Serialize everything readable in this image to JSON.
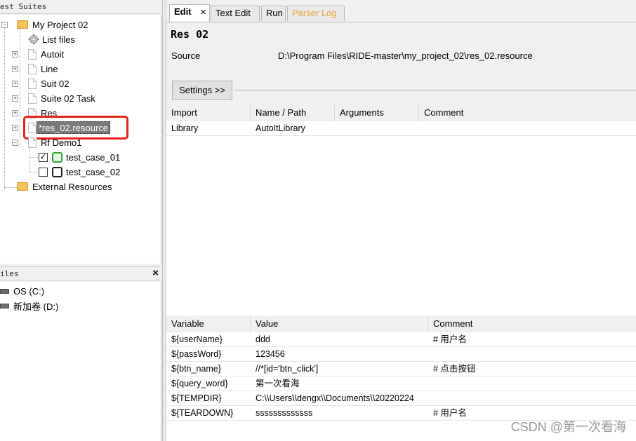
{
  "tree_panel": {
    "header": "est Suites",
    "items": [
      {
        "label": "My Project 02",
        "icon": "folder-icon"
      },
      {
        "label": "List files",
        "icon": "gear-icon"
      },
      {
        "label": "Autoit",
        "icon": "file-icon"
      },
      {
        "label": "Line",
        "icon": "file-icon"
      },
      {
        "label": "Suit 02",
        "icon": "file-icon"
      },
      {
        "label": "Suite 02 Task",
        "icon": "file-icon"
      },
      {
        "label": "Res",
        "icon": "gear-file-icon"
      },
      {
        "label": "*res_02.resource",
        "icon": "gear-file-icon"
      },
      {
        "label": "Rf Demo1",
        "icon": "file-icon"
      },
      {
        "label": "test_case_01",
        "icon": "robot-green-icon"
      },
      {
        "label": "test_case_02",
        "icon": "robot-black-icon"
      },
      {
        "label": "External Resources",
        "icon": "folder-gear-icon"
      }
    ]
  },
  "files_panel": {
    "header": "iles",
    "close": "×",
    "drives": [
      {
        "label": "OS (C:)"
      },
      {
        "label": "新加卷 (D:)"
      }
    ]
  },
  "tabs": [
    {
      "label": "Edit",
      "close": "×"
    },
    {
      "label": "Text Edit"
    },
    {
      "label": "Run"
    },
    {
      "label": "Parser Log",
      "color": "#e8a33c"
    }
  ],
  "resource": {
    "title": "Res 02",
    "source_label": "Source",
    "source_path": "D:\\Program Files\\RIDE-master\\my_project_02\\res_02.resource",
    "settings_button": "Settings >>"
  },
  "imports": {
    "columns": [
      "Import",
      "Name / Path",
      "Arguments",
      "Comment"
    ],
    "rows": [
      [
        "Library",
        "AutoItLibrary",
        "",
        ""
      ]
    ]
  },
  "variables": {
    "columns": [
      "Variable",
      "Value",
      "Comment"
    ],
    "rows": [
      [
        "${userName}",
        "ddd",
        "# 用户名"
      ],
      [
        "${passWord}",
        "123456",
        ""
      ],
      [
        "${btn_name}",
        "//*[id='btn_click']",
        "# 点击按钮"
      ],
      [
        "${query_word}",
        "第一次看海",
        ""
      ],
      [
        "${TEMPDIR}",
        "C:\\\\Users\\\\dengx\\\\Documents\\\\20220224",
        ""
      ],
      [
        "${TEARDOWN}",
        "sssssssssssss",
        "# 用户名"
      ]
    ]
  },
  "watermark": "CSDN @第一次看海",
  "highlight_color": "#e8231b"
}
